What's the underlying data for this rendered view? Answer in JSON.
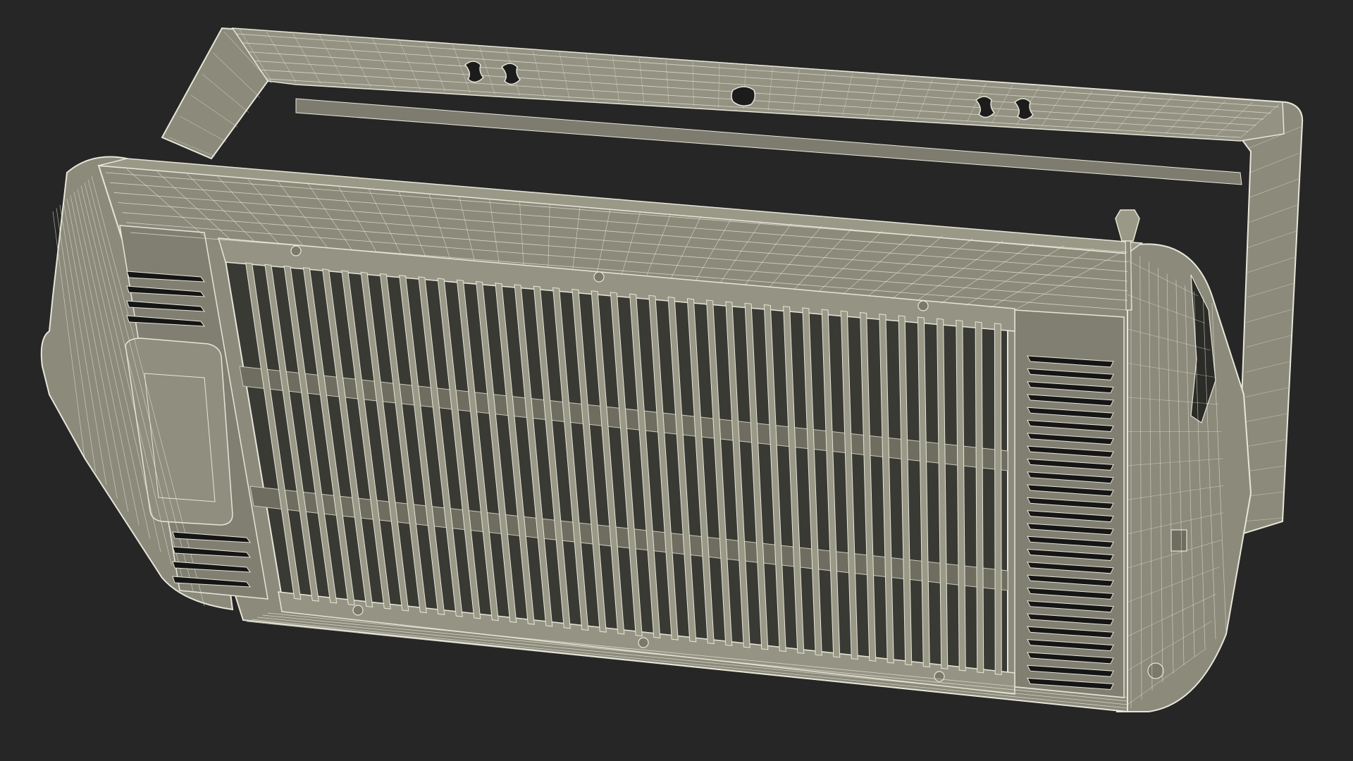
{
  "scene": {
    "subject": "quartz-heater-wireframe-model",
    "colors": {
      "background": "#262626",
      "body_fill": "#8b8a7b",
      "body_fill_light": "#9a9988",
      "body_fill_dark": "#6e6d60",
      "wire": "#e6e6d8",
      "slot_fill": "#151515",
      "interior": "#3a3a34"
    },
    "counts": {
      "grille_bars": 40,
      "right_vent_slots": 26,
      "left_top_vent_slots": 4,
      "left_bottom_vent_slots": 4
    }
  }
}
